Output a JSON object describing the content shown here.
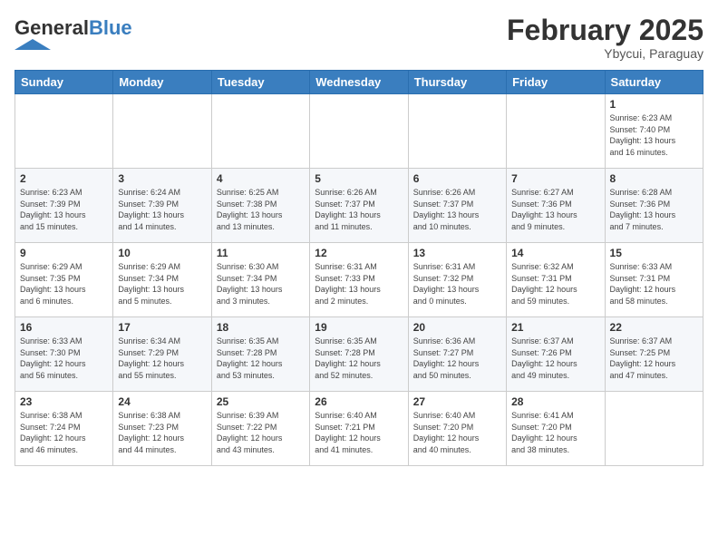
{
  "logo": {
    "general": "General",
    "blue": "Blue"
  },
  "header": {
    "month_year": "February 2025",
    "location": "Ybycui, Paraguay"
  },
  "weekdays": [
    "Sunday",
    "Monday",
    "Tuesday",
    "Wednesday",
    "Thursday",
    "Friday",
    "Saturday"
  ],
  "weeks": [
    [
      {
        "day": "",
        "info": ""
      },
      {
        "day": "",
        "info": ""
      },
      {
        "day": "",
        "info": ""
      },
      {
        "day": "",
        "info": ""
      },
      {
        "day": "",
        "info": ""
      },
      {
        "day": "",
        "info": ""
      },
      {
        "day": "1",
        "info": "Sunrise: 6:23 AM\nSunset: 7:40 PM\nDaylight: 13 hours\nand 16 minutes."
      }
    ],
    [
      {
        "day": "2",
        "info": "Sunrise: 6:23 AM\nSunset: 7:39 PM\nDaylight: 13 hours\nand 15 minutes."
      },
      {
        "day": "3",
        "info": "Sunrise: 6:24 AM\nSunset: 7:39 PM\nDaylight: 13 hours\nand 14 minutes."
      },
      {
        "day": "4",
        "info": "Sunrise: 6:25 AM\nSunset: 7:38 PM\nDaylight: 13 hours\nand 13 minutes."
      },
      {
        "day": "5",
        "info": "Sunrise: 6:26 AM\nSunset: 7:37 PM\nDaylight: 13 hours\nand 11 minutes."
      },
      {
        "day": "6",
        "info": "Sunrise: 6:26 AM\nSunset: 7:37 PM\nDaylight: 13 hours\nand 10 minutes."
      },
      {
        "day": "7",
        "info": "Sunrise: 6:27 AM\nSunset: 7:36 PM\nDaylight: 13 hours\nand 9 minutes."
      },
      {
        "day": "8",
        "info": "Sunrise: 6:28 AM\nSunset: 7:36 PM\nDaylight: 13 hours\nand 7 minutes."
      }
    ],
    [
      {
        "day": "9",
        "info": "Sunrise: 6:29 AM\nSunset: 7:35 PM\nDaylight: 13 hours\nand 6 minutes."
      },
      {
        "day": "10",
        "info": "Sunrise: 6:29 AM\nSunset: 7:34 PM\nDaylight: 13 hours\nand 5 minutes."
      },
      {
        "day": "11",
        "info": "Sunrise: 6:30 AM\nSunset: 7:34 PM\nDaylight: 13 hours\nand 3 minutes."
      },
      {
        "day": "12",
        "info": "Sunrise: 6:31 AM\nSunset: 7:33 PM\nDaylight: 13 hours\nand 2 minutes."
      },
      {
        "day": "13",
        "info": "Sunrise: 6:31 AM\nSunset: 7:32 PM\nDaylight: 13 hours\nand 0 minutes."
      },
      {
        "day": "14",
        "info": "Sunrise: 6:32 AM\nSunset: 7:31 PM\nDaylight: 12 hours\nand 59 minutes."
      },
      {
        "day": "15",
        "info": "Sunrise: 6:33 AM\nSunset: 7:31 PM\nDaylight: 12 hours\nand 58 minutes."
      }
    ],
    [
      {
        "day": "16",
        "info": "Sunrise: 6:33 AM\nSunset: 7:30 PM\nDaylight: 12 hours\nand 56 minutes."
      },
      {
        "day": "17",
        "info": "Sunrise: 6:34 AM\nSunset: 7:29 PM\nDaylight: 12 hours\nand 55 minutes."
      },
      {
        "day": "18",
        "info": "Sunrise: 6:35 AM\nSunset: 7:28 PM\nDaylight: 12 hours\nand 53 minutes."
      },
      {
        "day": "19",
        "info": "Sunrise: 6:35 AM\nSunset: 7:28 PM\nDaylight: 12 hours\nand 52 minutes."
      },
      {
        "day": "20",
        "info": "Sunrise: 6:36 AM\nSunset: 7:27 PM\nDaylight: 12 hours\nand 50 minutes."
      },
      {
        "day": "21",
        "info": "Sunrise: 6:37 AM\nSunset: 7:26 PM\nDaylight: 12 hours\nand 49 minutes."
      },
      {
        "day": "22",
        "info": "Sunrise: 6:37 AM\nSunset: 7:25 PM\nDaylight: 12 hours\nand 47 minutes."
      }
    ],
    [
      {
        "day": "23",
        "info": "Sunrise: 6:38 AM\nSunset: 7:24 PM\nDaylight: 12 hours\nand 46 minutes."
      },
      {
        "day": "24",
        "info": "Sunrise: 6:38 AM\nSunset: 7:23 PM\nDaylight: 12 hours\nand 44 minutes."
      },
      {
        "day": "25",
        "info": "Sunrise: 6:39 AM\nSunset: 7:22 PM\nDaylight: 12 hours\nand 43 minutes."
      },
      {
        "day": "26",
        "info": "Sunrise: 6:40 AM\nSunset: 7:21 PM\nDaylight: 12 hours\nand 41 minutes."
      },
      {
        "day": "27",
        "info": "Sunrise: 6:40 AM\nSunset: 7:20 PM\nDaylight: 12 hours\nand 40 minutes."
      },
      {
        "day": "28",
        "info": "Sunrise: 6:41 AM\nSunset: 7:20 PM\nDaylight: 12 hours\nand 38 minutes."
      },
      {
        "day": "",
        "info": ""
      }
    ]
  ]
}
